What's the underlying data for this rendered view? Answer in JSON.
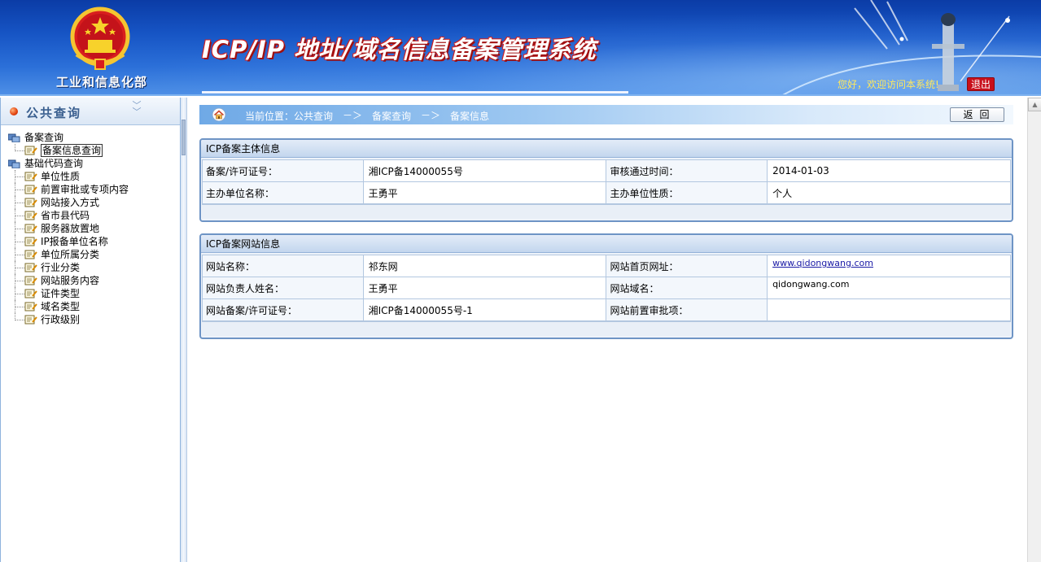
{
  "header": {
    "ministry": "工业和信息化部",
    "system_title": "ICP/IP 地址/域名信息备案管理系统",
    "welcome": "您好，欢迎访问本系统!",
    "logout_label": "退出"
  },
  "sidebar": {
    "title": "公共查询",
    "tree": [
      {
        "label": "备案查询",
        "children": [
          {
            "label": "备案信息查询",
            "selected": true
          }
        ]
      },
      {
        "label": "基础代码查询",
        "children": [
          {
            "label": "单位性质"
          },
          {
            "label": "前置审批或专项内容"
          },
          {
            "label": "网站接入方式"
          },
          {
            "label": "省市县代码"
          },
          {
            "label": "服务器放置地"
          },
          {
            "label": "IP报备单位名称"
          },
          {
            "label": "单位所属分类"
          },
          {
            "label": "行业分类"
          },
          {
            "label": "网站服务内容"
          },
          {
            "label": "证件类型"
          },
          {
            "label": "域名类型"
          },
          {
            "label": "行政级别"
          }
        ]
      }
    ]
  },
  "breadcrumb": {
    "prefix": "当前位置：公共查询",
    "arrow": "－＞",
    "items": [
      "备案查询",
      "备案信息"
    ],
    "back_label": "返回"
  },
  "subject_info": {
    "title": "ICP备案主体信息",
    "rows": [
      {
        "label1": "备案/许可证号：",
        "value1": "湘ICP备14000055号",
        "label2": "审核通过时间：",
        "value2": "2014-01-03"
      },
      {
        "label1": "主办单位名称：",
        "value1": "王勇平",
        "label2": "主办单位性质：",
        "value2": "个人"
      }
    ]
  },
  "website_info": {
    "title": "ICP备案网站信息",
    "rows": [
      {
        "label1": "网站名称：",
        "value1": "祁东网",
        "label2": "网站首页网址：",
        "value2": "www.qidongwang.com"
      },
      {
        "label1": "网站负责人姓名：",
        "value1": "王勇平",
        "label2": "网站域名：",
        "value2": "qidongwang.com"
      },
      {
        "label1": "网站备案/许可证号：",
        "value1": "湘ICP备14000055号-1",
        "label2": "网站前置审批项：",
        "value2": ""
      }
    ]
  }
}
